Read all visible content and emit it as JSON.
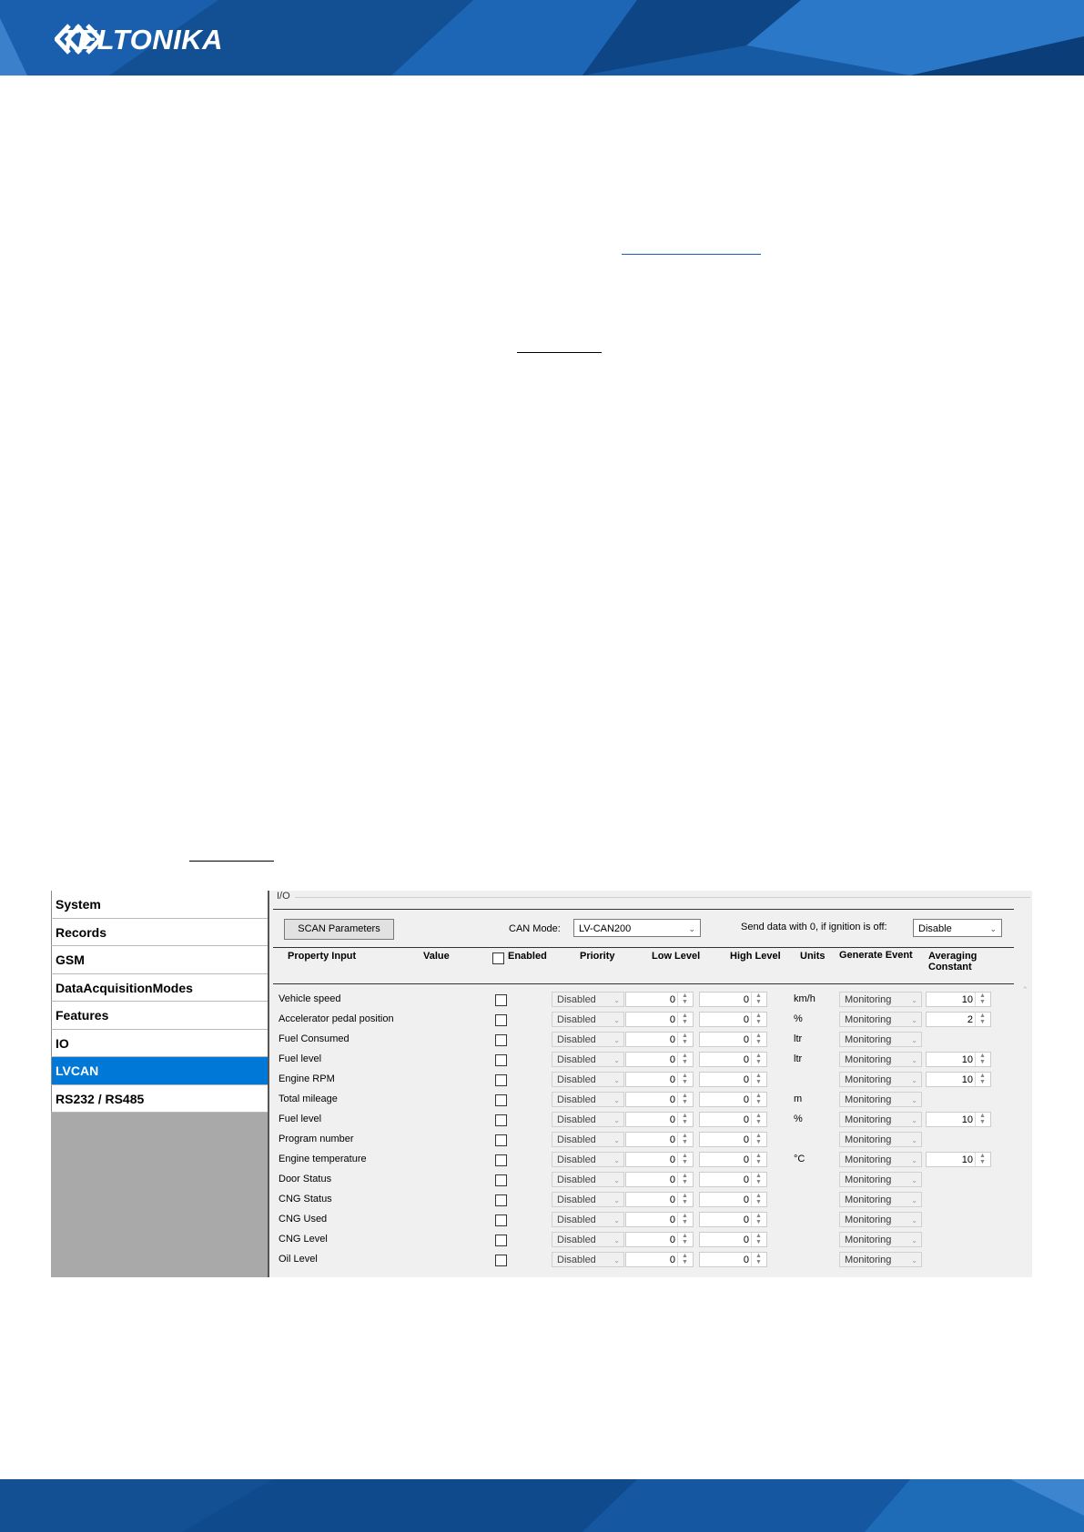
{
  "header": {
    "brand": "TELTONIKA",
    "logo_icon": "teltonika-chevron-logo-icon",
    "band_color": "#0f4f98"
  },
  "panel": {
    "sidebar": [
      {
        "label": "System",
        "active": false
      },
      {
        "label": "Records",
        "active": false
      },
      {
        "label": "GSM",
        "active": false
      },
      {
        "label": "DataAcquisitionModes",
        "active": false
      },
      {
        "label": "Features",
        "active": false
      },
      {
        "label": "IO",
        "active": false
      },
      {
        "label": "LVCAN",
        "active": true
      },
      {
        "label": "RS232 / RS485",
        "active": false
      }
    ],
    "group_label": "I/O",
    "scan_button": "SCAN Parameters",
    "can_mode_label": "CAN Mode:",
    "can_mode_value": "LV-CAN200",
    "send_label": "Send data with 0, if ignition is off:",
    "send_value": "Disable",
    "columns": {
      "property": "Property Input",
      "value": "Value",
      "enabled": "Enabled",
      "priority": "Priority",
      "low": "Low Level",
      "high": "High Level",
      "units": "Units",
      "generate": "Generate Event",
      "avg_line1": "Averaging",
      "avg_line2": "Constant"
    },
    "rows": [
      {
        "name": "Vehicle speed",
        "priority": "Disabled",
        "low": "0",
        "high": "0",
        "unit": "km/h",
        "event": "Monitoring",
        "avg": "10"
      },
      {
        "name": "Accelerator pedal position",
        "priority": "Disabled",
        "low": "0",
        "high": "0",
        "unit": "%",
        "event": "Monitoring",
        "avg": "2"
      },
      {
        "name": "Fuel Consumed",
        "priority": "Disabled",
        "low": "0",
        "high": "0",
        "unit": "ltr",
        "event": "Monitoring",
        "avg": ""
      },
      {
        "name": "Fuel level",
        "priority": "Disabled",
        "low": "0",
        "high": "0",
        "unit": "ltr",
        "event": "Monitoring",
        "avg": "10"
      },
      {
        "name": "Engine RPM",
        "priority": "Disabled",
        "low": "0",
        "high": "0",
        "unit": "",
        "event": "Monitoring",
        "avg": "10"
      },
      {
        "name": "Total mileage",
        "priority": "Disabled",
        "low": "0",
        "high": "0",
        "unit": "m",
        "event": "Monitoring",
        "avg": ""
      },
      {
        "name": "Fuel level",
        "priority": "Disabled",
        "low": "0",
        "high": "0",
        "unit": "%",
        "event": "Monitoring",
        "avg": "10"
      },
      {
        "name": "Program number",
        "priority": "Disabled",
        "low": "0",
        "high": "0",
        "unit": "",
        "event": "Monitoring",
        "avg": ""
      },
      {
        "name": "Engine temperature",
        "priority": "Disabled",
        "low": "0",
        "high": "0",
        "unit": "°C",
        "event": "Monitoring",
        "avg": "10"
      },
      {
        "name": "Door Status",
        "priority": "Disabled",
        "low": "0",
        "high": "0",
        "unit": "",
        "event": "Monitoring",
        "avg": ""
      },
      {
        "name": "CNG Status",
        "priority": "Disabled",
        "low": "0",
        "high": "0",
        "unit": "",
        "event": "Monitoring",
        "avg": ""
      },
      {
        "name": "CNG Used",
        "priority": "Disabled",
        "low": "0",
        "high": "0",
        "unit": "",
        "event": "Monitoring",
        "avg": ""
      },
      {
        "name": "CNG Level",
        "priority": "Disabled",
        "low": "0",
        "high": "0",
        "unit": "",
        "event": "Monitoring",
        "avg": ""
      },
      {
        "name": "Oil Level",
        "priority": "Disabled",
        "low": "0",
        "high": "0",
        "unit": "",
        "event": "Monitoring",
        "avg": ""
      }
    ]
  }
}
